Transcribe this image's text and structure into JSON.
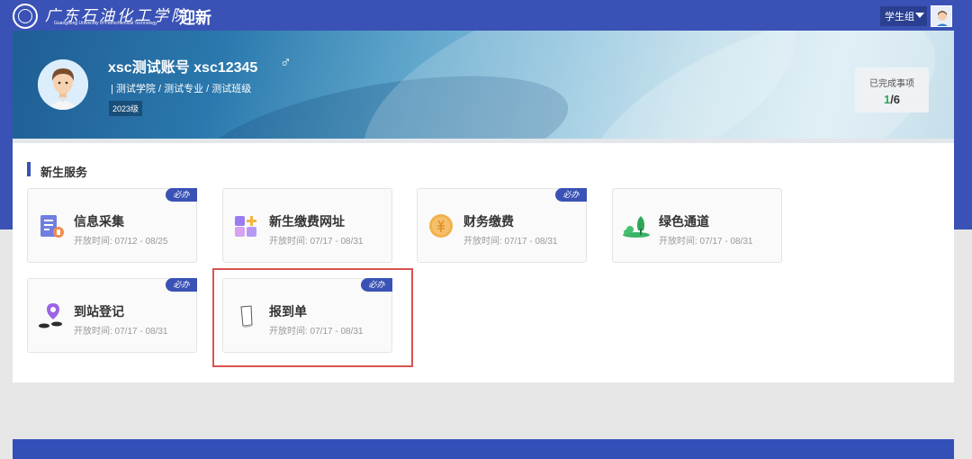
{
  "header": {
    "school_name_cn": "广东石油化工学院",
    "school_name_en": "Guangdong University of Petrochemical Technology",
    "module_title": "迎新",
    "role_label": "学生组"
  },
  "profile": {
    "name_line": "xsc测试账号  xsc12345",
    "gender_symbol": "♂",
    "meta": "| 测试学院 / 测试专业 / 测试班级",
    "grade": "2023级"
  },
  "progress": {
    "label": "已完成事项",
    "done": "1",
    "total_text": "/6"
  },
  "section": {
    "title": "新生服务"
  },
  "services": [
    {
      "title": "信息采集",
      "time": "开放时间: 07/12 - 08/25",
      "badge": "必办",
      "icon": "info-collect-icon"
    },
    {
      "title": "新生缴费网址",
      "time": "开放时间: 07/17 - 08/31",
      "badge": "",
      "icon": "apps-grid-icon"
    },
    {
      "title": "财务缴费",
      "time": "开放时间: 07/17 - 08/31",
      "badge": "必办",
      "icon": "coin-icon"
    },
    {
      "title": "绿色通道",
      "time": "开放时间: 07/17 - 08/31",
      "badge": "",
      "icon": "green-tree-icon"
    },
    {
      "title": "到站登记",
      "time": "开放时间: 07/17 - 08/31",
      "badge": "必办",
      "icon": "location-pin-icon"
    },
    {
      "title": "报到单",
      "time": "开放时间: 07/17 - 08/31",
      "badge": "必办",
      "icon": "document-icon"
    }
  ],
  "colors": {
    "brand": "#3a52b5",
    "highlight": "#d9534f",
    "done": "#2ca45a"
  }
}
